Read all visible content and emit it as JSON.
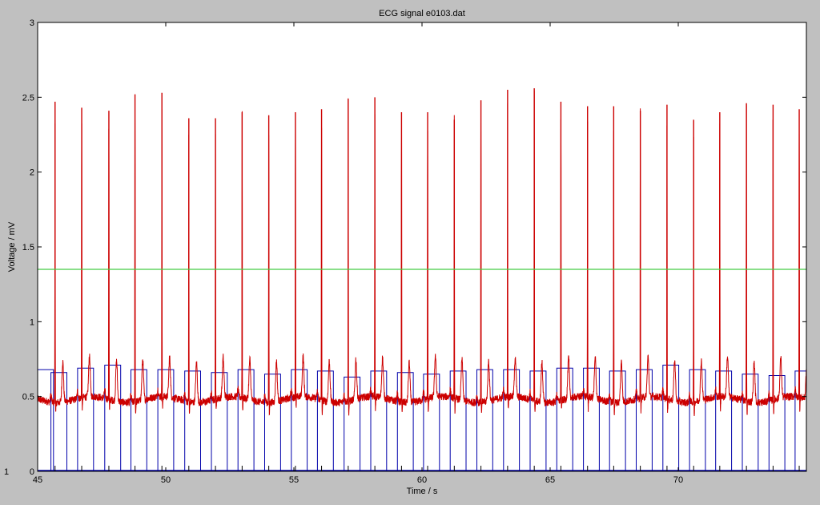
{
  "chart_data": {
    "type": "line",
    "title": "ECG signal e0103.dat",
    "xlabel": "Time / s",
    "ylabel": "Voltage / mV",
    "xlim": [
      45,
      75
    ],
    "ylim": [
      0,
      3
    ],
    "x_ticks": [
      45,
      50,
      55,
      60,
      65,
      70
    ],
    "x_tick_labels": [
      "45",
      "50",
      "55",
      "60",
      "65",
      "70"
    ],
    "y_ticks": [
      0,
      0.5,
      1,
      1.5,
      2,
      2.5,
      3
    ],
    "y_tick_labels": [
      "0",
      "0.5",
      "1",
      "1.5",
      "2",
      "2.5",
      "3"
    ],
    "extra_left_label": "1",
    "grid": false,
    "series": [
      {
        "kind": "ecg",
        "color": "#cc0000",
        "baseline_mV": 0.48,
        "r_peaks": [
          {
            "t": 45.68,
            "v": 2.47
          },
          {
            "t": 46.72,
            "v": 2.43
          },
          {
            "t": 47.78,
            "v": 2.41
          },
          {
            "t": 48.8,
            "v": 2.52
          },
          {
            "t": 49.85,
            "v": 2.53
          },
          {
            "t": 50.9,
            "v": 2.36
          },
          {
            "t": 51.94,
            "v": 2.36
          },
          {
            "t": 52.98,
            "v": 2.4
          },
          {
            "t": 54.02,
            "v": 2.38
          },
          {
            "t": 55.06,
            "v": 2.4
          },
          {
            "t": 56.08,
            "v": 2.42
          },
          {
            "t": 57.12,
            "v": 2.49
          },
          {
            "t": 58.16,
            "v": 2.5
          },
          {
            "t": 59.2,
            "v": 2.4
          },
          {
            "t": 60.22,
            "v": 2.4
          },
          {
            "t": 61.26,
            "v": 2.35
          },
          {
            "t": 62.3,
            "v": 2.48
          },
          {
            "t": 63.34,
            "v": 2.55
          },
          {
            "t": 64.38,
            "v": 2.56
          },
          {
            "t": 65.42,
            "v": 2.47
          },
          {
            "t": 66.46,
            "v": 2.44
          },
          {
            "t": 67.48,
            "v": 2.44
          },
          {
            "t": 68.52,
            "v": 2.41
          },
          {
            "t": 69.56,
            "v": 2.45
          },
          {
            "t": 70.6,
            "v": 2.35
          },
          {
            "t": 71.62,
            "v": 2.4
          },
          {
            "t": 72.66,
            "v": 2.46
          },
          {
            "t": 73.7,
            "v": 2.45
          },
          {
            "t": 74.72,
            "v": 2.42
          }
        ],
        "t_wave_peak_mV": 0.8
      },
      {
        "kind": "threshold",
        "color": "#44cc44",
        "value": 1.35
      },
      {
        "kind": "pulse",
        "color": "#0000aa",
        "high_levels_mV": [
          0.68,
          0.66,
          0.69,
          0.71,
          0.68,
          0.68,
          0.67,
          0.66,
          0.68,
          0.65,
          0.68,
          0.67,
          0.63,
          0.67,
          0.66,
          0.65,
          0.67,
          0.68,
          0.68,
          0.67,
          0.69,
          0.69,
          0.67,
          0.68,
          0.71,
          0.68,
          0.67,
          0.65,
          0.64,
          0.67,
          0.5
        ]
      }
    ]
  }
}
